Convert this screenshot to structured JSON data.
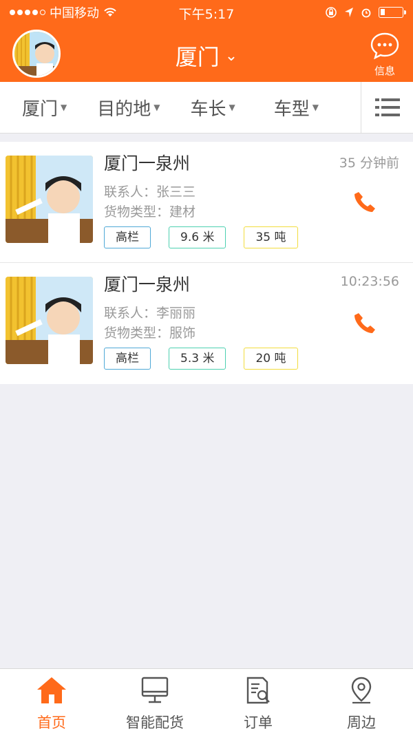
{
  "statusbar": {
    "carrier": "中国移动",
    "time": "下午5:17"
  },
  "header": {
    "title": "厦门",
    "message_label": "信息"
  },
  "filters": {
    "city": "厦门",
    "destination": "目的地",
    "length": "车长",
    "type": "车型"
  },
  "listings": [
    {
      "route": "厦门一泉州",
      "time": "35 分钟前",
      "contact": "联系人：张三三",
      "goods": "货物类型：建材",
      "tags": [
        "高栏",
        "9.6 米",
        "35 吨"
      ]
    },
    {
      "route": "厦门一泉州",
      "time": "10:23:56",
      "contact": "联系人：李丽丽",
      "goods": "货物类型：服饰",
      "tags": [
        "高栏",
        "5.3 米",
        "20 吨"
      ]
    }
  ],
  "tabbar": {
    "items": [
      {
        "label": "首页",
        "icon": "home-icon",
        "active": true
      },
      {
        "label": "智能配货",
        "icon": "monitor-icon",
        "active": false
      },
      {
        "label": "订单",
        "icon": "order-icon",
        "active": false
      },
      {
        "label": "周边",
        "icon": "location-pin-icon",
        "active": false
      }
    ]
  },
  "colors": {
    "brand": "#ff6a1a",
    "tag_blue": "#4ea8d6",
    "tag_green": "#4cd0b0",
    "tag_yellow": "#f2dc3c"
  }
}
